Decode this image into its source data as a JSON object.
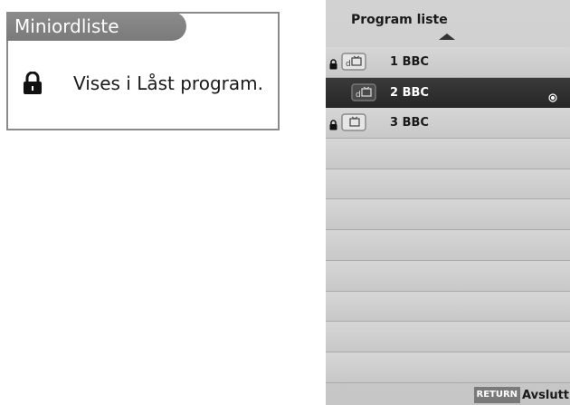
{
  "glossary": {
    "title": "Miniordliste",
    "entry_icon": "lock-icon",
    "entry_text": "Vises i Låst program."
  },
  "program_list": {
    "title": "Program liste",
    "scroll_up_icon": "up-arrow-icon",
    "programs": [
      {
        "label": "1 BBC",
        "locked": true,
        "selected": false,
        "icon": "tv-dtv-icon"
      },
      {
        "label": "2 BBC",
        "locked": false,
        "selected": true,
        "icon": "tv-dtv-icon"
      },
      {
        "label": "3 BBC",
        "locked": true,
        "selected": false,
        "icon": "tv-atv-icon"
      }
    ],
    "empty_rows": 8
  },
  "footer": {
    "return_label": "RETURN",
    "exit_label": "Avslutt"
  }
}
